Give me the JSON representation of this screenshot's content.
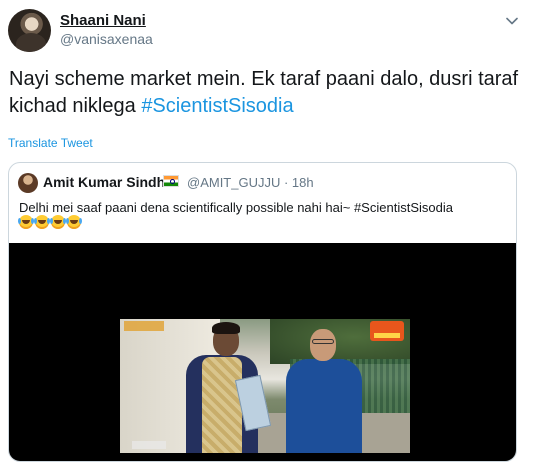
{
  "tweet": {
    "display_name": "Shaani Nani",
    "handle": "@vanisaxenaa",
    "text_main": "Nayi scheme market mein. Ek taraf paani dalo, dusri taraf kichad niklega ",
    "text_hashtag": "#ScientistSisodia",
    "translate_label": "Translate Tweet",
    "menu_icon": "chevron-down-icon"
  },
  "quoted_tweet": {
    "display_name": "Amit Kumar Sindhi",
    "flag_icon": "india-flag-icon",
    "handle_time": "@AMIT_GUJJU · 18h",
    "text": "Delhi mei saaf paani dena scientifically possible nahi hai~ ",
    "hashtag": "#ScientistSisodia",
    "emojis": [
      "tears-of-joy-icon",
      "tears-of-joy-icon",
      "tears-of-joy-icon",
      "tears-of-joy-icon"
    ]
  },
  "colors": {
    "link": "#1b95e0",
    "secondary_text": "#657786",
    "border": "#ccd6dd"
  }
}
